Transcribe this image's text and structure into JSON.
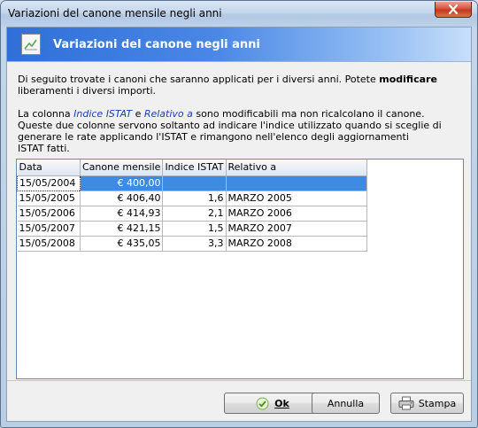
{
  "window": {
    "title": "Variazioni del canone mensile negli anni"
  },
  "header": {
    "title": "Variazioni del canone negli anni"
  },
  "description": {
    "p1_a": "Di seguito trovate i canoni che saranno applicati per i diversi anni. Potete ",
    "p1_bold": "modificare",
    "p1_b": "liberamenti i diversi importi.",
    "p2_a": "La colonna ",
    "p2_em1": "Indice ISTAT",
    "p2_b": " e ",
    "p2_em2": "Relativo a",
    "p2_c": " sono modificabili ma non ricalcolano il canone.",
    "p2_d": "Queste due colonne servono soltanto ad indicare l'indice utilizzato quando si sceglie di",
    "p2_e": "generare le rate applicando l'ISTAT e rimangono nell'elenco degli aggiornamenti",
    "p2_f": "ISTAT fatti."
  },
  "grid": {
    "columns": [
      "Data",
      "Canone mensile",
      "Indice ISTAT",
      "Relativo a"
    ],
    "rows": [
      {
        "data": "15/05/2004",
        "canone": "€ 400,00",
        "indice": "",
        "relativo": ""
      },
      {
        "data": "15/05/2005",
        "canone": "€ 406,40",
        "indice": "1,6",
        "relativo": "MARZO 2005"
      },
      {
        "data": "15/05/2006",
        "canone": "€ 414,93",
        "indice": "2,1",
        "relativo": "MARZO 2006"
      },
      {
        "data": "15/05/2007",
        "canone": "€ 421,15",
        "indice": "1,5",
        "relativo": "MARZO 2007"
      },
      {
        "data": "15/05/2008",
        "canone": "€ 435,05",
        "indice": "3,3",
        "relativo": "MARZO 2008"
      }
    ]
  },
  "buttons": {
    "ok": "Ok",
    "annulla": "Annulla",
    "stampa": "Stampa"
  }
}
